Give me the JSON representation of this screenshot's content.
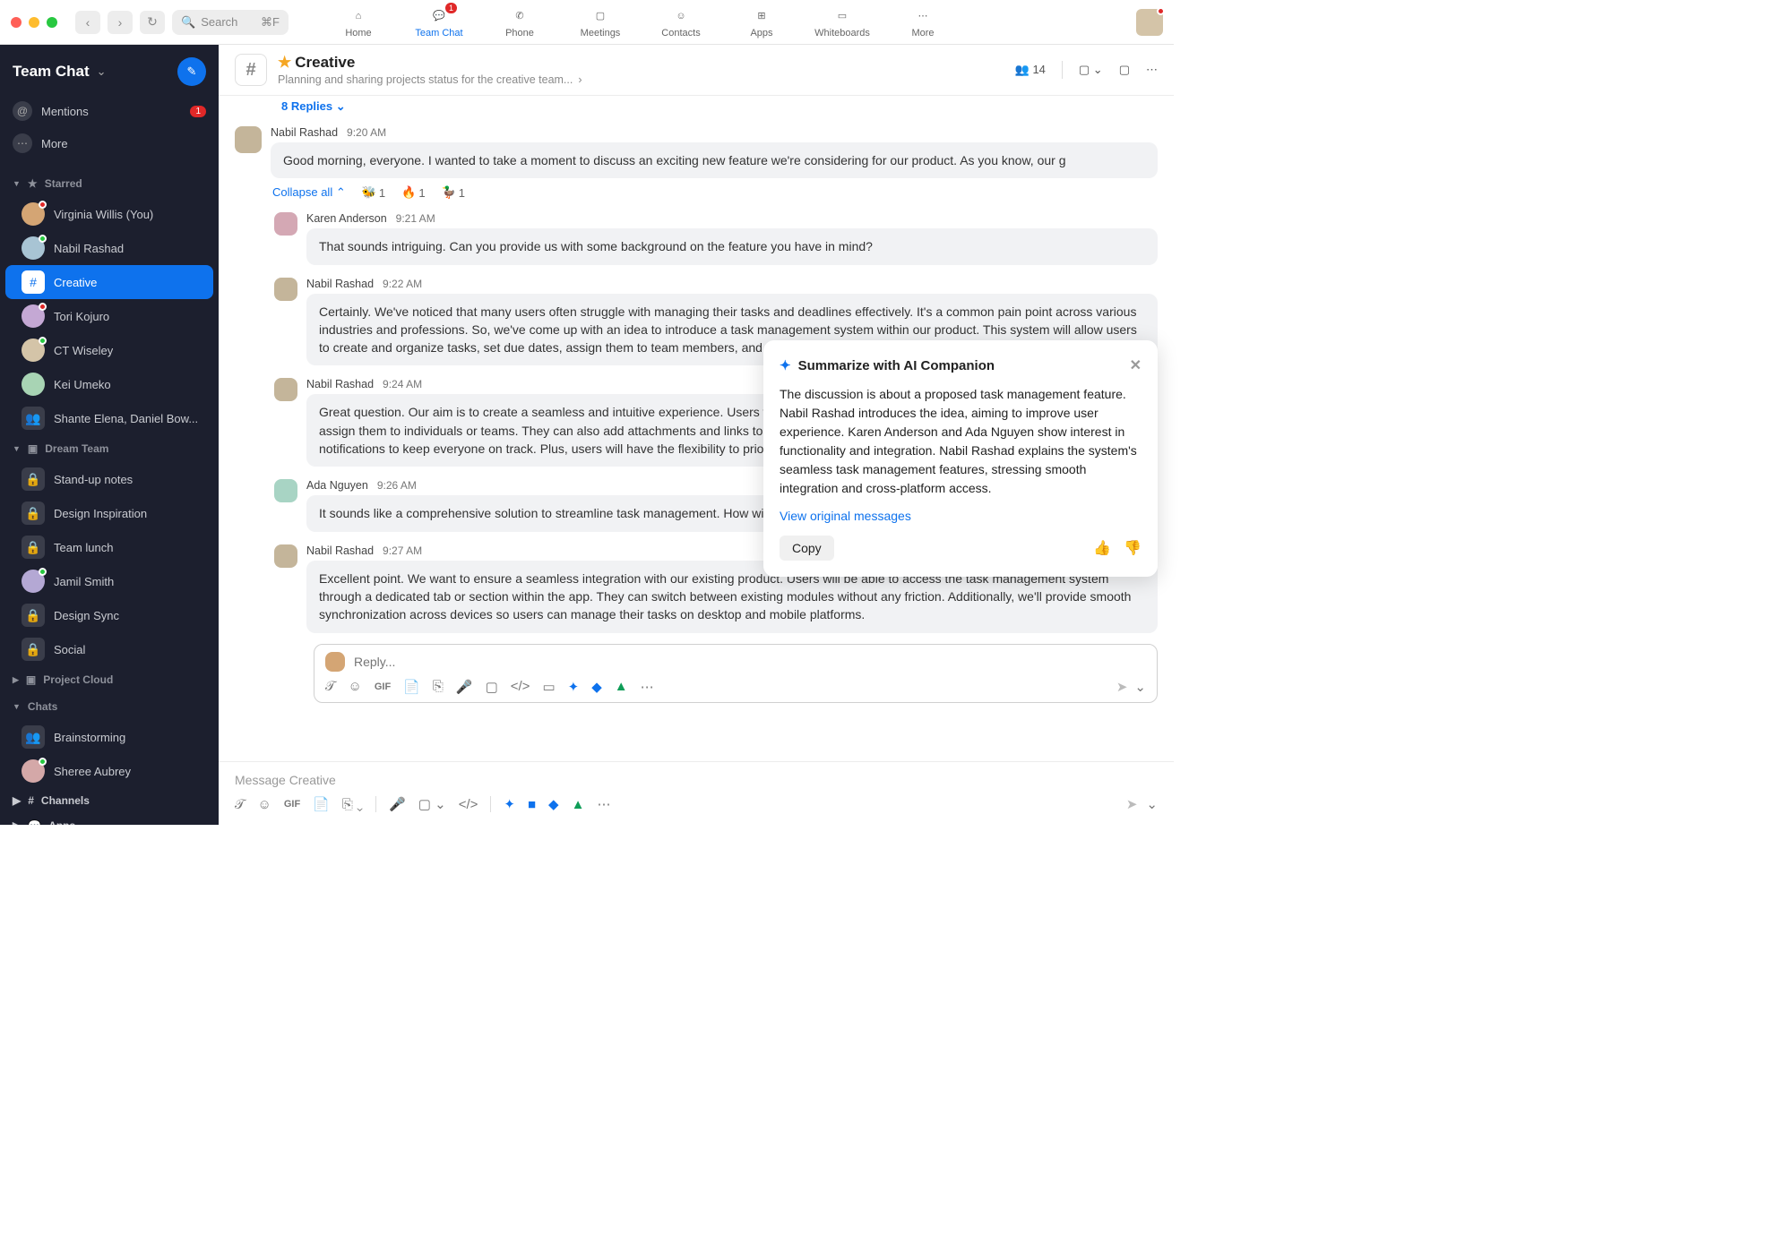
{
  "titlebar": {
    "search_placeholder": "Search",
    "search_shortcut": "⌘F"
  },
  "nav": {
    "items": [
      {
        "label": "Home",
        "active": false,
        "badge": null
      },
      {
        "label": "Team Chat",
        "active": true,
        "badge": "1"
      },
      {
        "label": "Phone",
        "active": false,
        "badge": null
      },
      {
        "label": "Meetings",
        "active": false,
        "badge": null
      },
      {
        "label": "Contacts",
        "active": false,
        "badge": null
      },
      {
        "label": "Apps",
        "active": false,
        "badge": null
      },
      {
        "label": "Whiteboards",
        "active": false,
        "badge": null
      },
      {
        "label": "More",
        "active": false,
        "badge": null
      }
    ]
  },
  "sidebar": {
    "title": "Team Chat",
    "mentions": {
      "label": "Mentions",
      "badge": "1"
    },
    "more": {
      "label": "More"
    },
    "sections": {
      "starred": {
        "title": "Starred",
        "items": [
          {
            "label": "Virginia Willis (You)",
            "type": "user",
            "presence": "red"
          },
          {
            "label": "Nabil Rashad",
            "type": "user",
            "presence": "green"
          },
          {
            "label": "Creative",
            "type": "channel",
            "active": true
          },
          {
            "label": "Tori Kojuro",
            "type": "user",
            "presence": "red"
          },
          {
            "label": "CT Wiseley",
            "type": "user",
            "presence": "green"
          },
          {
            "label": "Kei Umeko",
            "type": "user",
            "presence": null
          },
          {
            "label": "Shante Elena, Daniel Bow...",
            "type": "group"
          }
        ]
      },
      "dream_team": {
        "title": "Dream Team",
        "items": [
          {
            "label": "Stand-up notes",
            "type": "lock"
          },
          {
            "label": "Design Inspiration",
            "type": "lock"
          },
          {
            "label": "Team lunch",
            "type": "lock"
          },
          {
            "label": "Jamil Smith",
            "type": "user",
            "presence": "green"
          },
          {
            "label": "Design Sync",
            "type": "lock"
          },
          {
            "label": "Social",
            "type": "lock"
          }
        ]
      },
      "project_cloud": {
        "title": "Project Cloud"
      },
      "chats": {
        "title": "Chats",
        "items": [
          {
            "label": "Brainstorming",
            "type": "group"
          },
          {
            "label": "Sheree Aubrey",
            "type": "user",
            "presence": "green"
          }
        ]
      }
    },
    "fixed": {
      "channels": "Channels",
      "apps": "Apps"
    }
  },
  "channel": {
    "name": "Creative",
    "description": "Planning and sharing projects status for the creative team...",
    "members": "14"
  },
  "thread_header": {
    "replies": "8 Replies",
    "collapse": "Collapse all",
    "reactions": [
      {
        "emoji": "🐝",
        "count": "1"
      },
      {
        "emoji": "🔥",
        "count": "1"
      },
      {
        "emoji": "🦆",
        "count": "1"
      }
    ]
  },
  "messages": [
    {
      "author": "Nabil Rashad",
      "time": "9:20 AM",
      "text": "Good morning, everyone. I wanted to take a moment to discuss an exciting new feature we're considering for our product. As you know, our g"
    },
    {
      "author": "Karen Anderson",
      "time": "9:21 AM",
      "text": "That sounds intriguing. Can you provide us with some background on the feature you have in mind?"
    },
    {
      "author": "Nabil Rashad",
      "time": "9:22 AM",
      "text": "Certainly. We've noticed that many users often struggle with managing their tasks and deadlines effectively. It's a common pain point across various industries and professions. So, we've come up with an idea to introduce a task management system within our product. This system will allow users to create and organize tasks, set due dates, assign them to team members, and track progress—all in one centralized location."
    },
    {
      "author": "Nabil Rashad",
      "time": "9:24 AM",
      "text": "Great question. Our aim is to create a seamless and intuitive experience. Users will be able to create tasks with titles, descriptions, due dates, and assign them to individuals or teams. They can also add attachments and links to provide comprehensive context. The system will offer reminders and notifications to keep everyone on track. Plus, users will have the flexibility to prioritize and categorize tasks based on their preferences."
    },
    {
      "author": "Ada Nguyen",
      "time": "9:26 AM",
      "text": "It sounds like a comprehensive solution to streamline task management. How will it integrate with our existing features?"
    },
    {
      "author": "Nabil Rashad",
      "time": "9:27 AM",
      "text": "Excellent point. We want to ensure a seamless integration with our existing product. Users will be able to access the task management system through a dedicated tab or section within the app. They can switch between existing modules without any friction. Additionally, we'll provide smooth synchronization across devices so users can manage their tasks on desktop and mobile platforms."
    }
  ],
  "reply": {
    "placeholder": "Reply..."
  },
  "compose": {
    "placeholder": "Message Creative"
  },
  "ai": {
    "title": "Summarize with AI Companion",
    "body": "The discussion is about a proposed task management feature. Nabil Rashad introduces the idea, aiming to improve user experience. Karen Anderson and Ada Nguyen show interest in functionality and integration. Nabil Rashad explains the system's seamless task management features, stressing smooth integration and cross-platform access.",
    "link": "View original messages",
    "copy": "Copy"
  }
}
